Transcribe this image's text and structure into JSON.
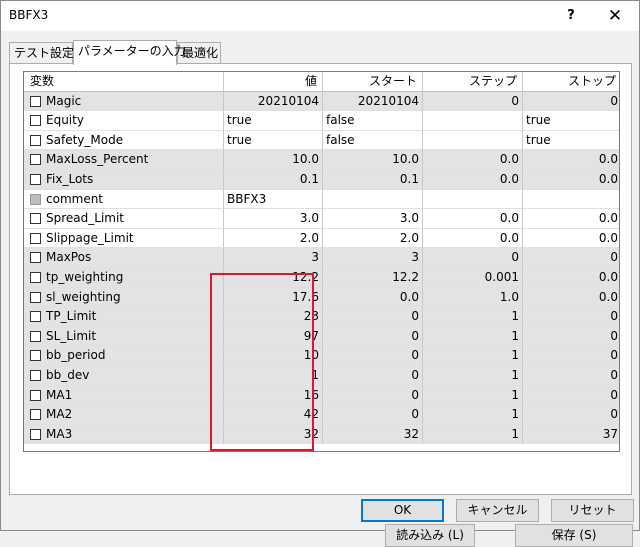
{
  "window": {
    "title": "BBFX3",
    "help_label": "?",
    "close_label": "✕"
  },
  "tabs": [
    {
      "label": "テスト設定"
    },
    {
      "label": "パラメーターの入力"
    },
    {
      "label": "最適化"
    }
  ],
  "grid": {
    "headers": [
      "変数",
      "値",
      "スタート",
      "ステップ",
      "ストップ"
    ],
    "rows": [
      {
        "name": "Magic",
        "value": "20210104",
        "start": "20210104",
        "step": "0",
        "stop": "0"
      },
      {
        "name": "Equity",
        "value": "true",
        "start": "false",
        "step": "",
        "stop": "true"
      },
      {
        "name": "Safety_Mode",
        "value": "true",
        "start": "false",
        "step": "",
        "stop": "true"
      },
      {
        "name": "MaxLoss_Percent",
        "value": "10.0",
        "start": "10.0",
        "step": "0.0",
        "stop": "0.0"
      },
      {
        "name": "Fix_Lots",
        "value": "0.1",
        "start": "0.1",
        "step": "0.0",
        "stop": "0.0"
      },
      {
        "name": "comment",
        "value": "BBFX3",
        "start": "",
        "step": "",
        "stop": ""
      },
      {
        "name": "Spread_Limit",
        "value": "3.0",
        "start": "3.0",
        "step": "0.0",
        "stop": "0.0"
      },
      {
        "name": "Slippage_Limit",
        "value": "2.0",
        "start": "2.0",
        "step": "0.0",
        "stop": "0.0"
      },
      {
        "name": "MaxPos",
        "value": "3",
        "start": "3",
        "step": "0",
        "stop": "0"
      },
      {
        "name": "tp_weighting",
        "value": "12.2",
        "start": "12.2",
        "step": "0.001",
        "stop": "0.0"
      },
      {
        "name": "sl_weighting",
        "value": "17.6",
        "start": "0.0",
        "step": "1.0",
        "stop": "0.0"
      },
      {
        "name": "TP_Limit",
        "value": "23",
        "start": "0",
        "step": "1",
        "stop": "0"
      },
      {
        "name": "SL_Limit",
        "value": "97",
        "start": "0",
        "step": "1",
        "stop": "0"
      },
      {
        "name": "bb_period",
        "value": "10",
        "start": "0",
        "step": "1",
        "stop": "0"
      },
      {
        "name": "bb_dev",
        "value": "1",
        "start": "0",
        "step": "1",
        "stop": "0"
      },
      {
        "name": "MA1",
        "value": "16",
        "start": "0",
        "step": "1",
        "stop": "0"
      },
      {
        "name": "MA2",
        "value": "42",
        "start": "0",
        "step": "1",
        "stop": "0"
      },
      {
        "name": "MA3",
        "value": "32",
        "start": "32",
        "step": "1",
        "stop": "37"
      }
    ]
  },
  "buttons": {
    "load": "読み込み (L)",
    "save": "保存 (S)",
    "ok": "OK",
    "cancel": "キャンセル",
    "reset": "リセット"
  },
  "colors": {
    "highlight": "#e0162b",
    "default_button_border": "#0078d7"
  }
}
